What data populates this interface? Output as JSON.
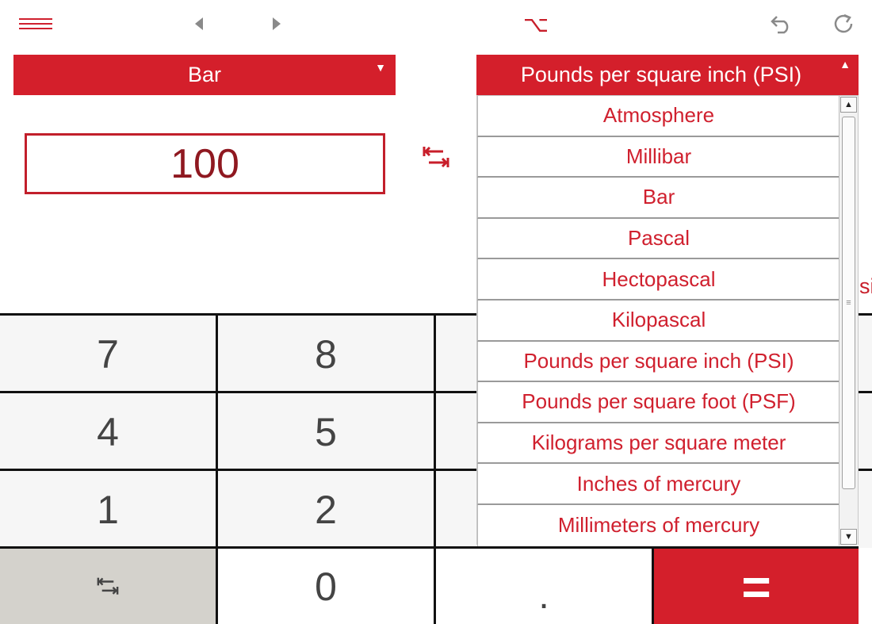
{
  "toolbar": {
    "menu_icon": "hamburger-icon",
    "back_icon": "arrow-left-icon",
    "forward_icon": "arrow-right-icon",
    "option_glyph": "⌥",
    "undo_icon": "undo-icon",
    "redo_icon": "redo-icon"
  },
  "from_unit": {
    "selected": "Bar",
    "caret": "▼"
  },
  "to_unit": {
    "selected": "Pounds per square inch (PSI)",
    "caret": "▲"
  },
  "input": {
    "value": "100"
  },
  "result_partial": "si",
  "dropdown": {
    "options": [
      "Atmosphere",
      "Millibar",
      "Bar",
      "Pascal",
      "Hectopascal",
      "Kilopascal",
      "Pounds per square inch (PSI)",
      "Pounds per square foot (PSF)",
      "Kilograms per square meter",
      "Inches of mercury",
      "Millimeters of mercury"
    ],
    "scroll_up": "▲",
    "scroll_down": "▼",
    "thumb_grip": "≡"
  },
  "keypad": {
    "k7": "7",
    "k8": "8",
    "k4": "4",
    "k5": "5",
    "k1": "1",
    "k2": "2",
    "k0": "0",
    "dot": ".",
    "equals": "="
  },
  "colors": {
    "accent": "#d41f2b",
    "text_red": "#d0202e",
    "input_text": "#8f1820",
    "swap_key_bg": "#d4d2cc"
  }
}
